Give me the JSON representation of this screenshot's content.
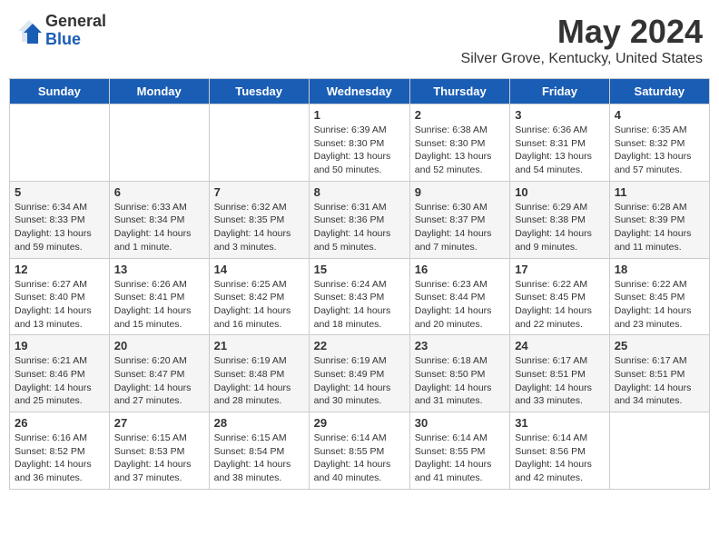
{
  "header": {
    "logo_general": "General",
    "logo_blue": "Blue",
    "month_title": "May 2024",
    "location": "Silver Grove, Kentucky, United States"
  },
  "days_of_week": [
    "Sunday",
    "Monday",
    "Tuesday",
    "Wednesday",
    "Thursday",
    "Friday",
    "Saturday"
  ],
  "weeks": [
    [
      {
        "day": "",
        "sunrise": "",
        "sunset": "",
        "daylight": ""
      },
      {
        "day": "",
        "sunrise": "",
        "sunset": "",
        "daylight": ""
      },
      {
        "day": "",
        "sunrise": "",
        "sunset": "",
        "daylight": ""
      },
      {
        "day": "1",
        "sunrise": "Sunrise: 6:39 AM",
        "sunset": "Sunset: 8:30 PM",
        "daylight": "Daylight: 13 hours and 50 minutes."
      },
      {
        "day": "2",
        "sunrise": "Sunrise: 6:38 AM",
        "sunset": "Sunset: 8:30 PM",
        "daylight": "Daylight: 13 hours and 52 minutes."
      },
      {
        "day": "3",
        "sunrise": "Sunrise: 6:36 AM",
        "sunset": "Sunset: 8:31 PM",
        "daylight": "Daylight: 13 hours and 54 minutes."
      },
      {
        "day": "4",
        "sunrise": "Sunrise: 6:35 AM",
        "sunset": "Sunset: 8:32 PM",
        "daylight": "Daylight: 13 hours and 57 minutes."
      }
    ],
    [
      {
        "day": "5",
        "sunrise": "Sunrise: 6:34 AM",
        "sunset": "Sunset: 8:33 PM",
        "daylight": "Daylight: 13 hours and 59 minutes."
      },
      {
        "day": "6",
        "sunrise": "Sunrise: 6:33 AM",
        "sunset": "Sunset: 8:34 PM",
        "daylight": "Daylight: 14 hours and 1 minute."
      },
      {
        "day": "7",
        "sunrise": "Sunrise: 6:32 AM",
        "sunset": "Sunset: 8:35 PM",
        "daylight": "Daylight: 14 hours and 3 minutes."
      },
      {
        "day": "8",
        "sunrise": "Sunrise: 6:31 AM",
        "sunset": "Sunset: 8:36 PM",
        "daylight": "Daylight: 14 hours and 5 minutes."
      },
      {
        "day": "9",
        "sunrise": "Sunrise: 6:30 AM",
        "sunset": "Sunset: 8:37 PM",
        "daylight": "Daylight: 14 hours and 7 minutes."
      },
      {
        "day": "10",
        "sunrise": "Sunrise: 6:29 AM",
        "sunset": "Sunset: 8:38 PM",
        "daylight": "Daylight: 14 hours and 9 minutes."
      },
      {
        "day": "11",
        "sunrise": "Sunrise: 6:28 AM",
        "sunset": "Sunset: 8:39 PM",
        "daylight": "Daylight: 14 hours and 11 minutes."
      }
    ],
    [
      {
        "day": "12",
        "sunrise": "Sunrise: 6:27 AM",
        "sunset": "Sunset: 8:40 PM",
        "daylight": "Daylight: 14 hours and 13 minutes."
      },
      {
        "day": "13",
        "sunrise": "Sunrise: 6:26 AM",
        "sunset": "Sunset: 8:41 PM",
        "daylight": "Daylight: 14 hours and 15 minutes."
      },
      {
        "day": "14",
        "sunrise": "Sunrise: 6:25 AM",
        "sunset": "Sunset: 8:42 PM",
        "daylight": "Daylight: 14 hours and 16 minutes."
      },
      {
        "day": "15",
        "sunrise": "Sunrise: 6:24 AM",
        "sunset": "Sunset: 8:43 PM",
        "daylight": "Daylight: 14 hours and 18 minutes."
      },
      {
        "day": "16",
        "sunrise": "Sunrise: 6:23 AM",
        "sunset": "Sunset: 8:44 PM",
        "daylight": "Daylight: 14 hours and 20 minutes."
      },
      {
        "day": "17",
        "sunrise": "Sunrise: 6:22 AM",
        "sunset": "Sunset: 8:45 PM",
        "daylight": "Daylight: 14 hours and 22 minutes."
      },
      {
        "day": "18",
        "sunrise": "Sunrise: 6:22 AM",
        "sunset": "Sunset: 8:45 PM",
        "daylight": "Daylight: 14 hours and 23 minutes."
      }
    ],
    [
      {
        "day": "19",
        "sunrise": "Sunrise: 6:21 AM",
        "sunset": "Sunset: 8:46 PM",
        "daylight": "Daylight: 14 hours and 25 minutes."
      },
      {
        "day": "20",
        "sunrise": "Sunrise: 6:20 AM",
        "sunset": "Sunset: 8:47 PM",
        "daylight": "Daylight: 14 hours and 27 minutes."
      },
      {
        "day": "21",
        "sunrise": "Sunrise: 6:19 AM",
        "sunset": "Sunset: 8:48 PM",
        "daylight": "Daylight: 14 hours and 28 minutes."
      },
      {
        "day": "22",
        "sunrise": "Sunrise: 6:19 AM",
        "sunset": "Sunset: 8:49 PM",
        "daylight": "Daylight: 14 hours and 30 minutes."
      },
      {
        "day": "23",
        "sunrise": "Sunrise: 6:18 AM",
        "sunset": "Sunset: 8:50 PM",
        "daylight": "Daylight: 14 hours and 31 minutes."
      },
      {
        "day": "24",
        "sunrise": "Sunrise: 6:17 AM",
        "sunset": "Sunset: 8:51 PM",
        "daylight": "Daylight: 14 hours and 33 minutes."
      },
      {
        "day": "25",
        "sunrise": "Sunrise: 6:17 AM",
        "sunset": "Sunset: 8:51 PM",
        "daylight": "Daylight: 14 hours and 34 minutes."
      }
    ],
    [
      {
        "day": "26",
        "sunrise": "Sunrise: 6:16 AM",
        "sunset": "Sunset: 8:52 PM",
        "daylight": "Daylight: 14 hours and 36 minutes."
      },
      {
        "day": "27",
        "sunrise": "Sunrise: 6:15 AM",
        "sunset": "Sunset: 8:53 PM",
        "daylight": "Daylight: 14 hours and 37 minutes."
      },
      {
        "day": "28",
        "sunrise": "Sunrise: 6:15 AM",
        "sunset": "Sunset: 8:54 PM",
        "daylight": "Daylight: 14 hours and 38 minutes."
      },
      {
        "day": "29",
        "sunrise": "Sunrise: 6:14 AM",
        "sunset": "Sunset: 8:55 PM",
        "daylight": "Daylight: 14 hours and 40 minutes."
      },
      {
        "day": "30",
        "sunrise": "Sunrise: 6:14 AM",
        "sunset": "Sunset: 8:55 PM",
        "daylight": "Daylight: 14 hours and 41 minutes."
      },
      {
        "day": "31",
        "sunrise": "Sunrise: 6:14 AM",
        "sunset": "Sunset: 8:56 PM",
        "daylight": "Daylight: 14 hours and 42 minutes."
      },
      {
        "day": "",
        "sunrise": "",
        "sunset": "",
        "daylight": ""
      }
    ]
  ]
}
